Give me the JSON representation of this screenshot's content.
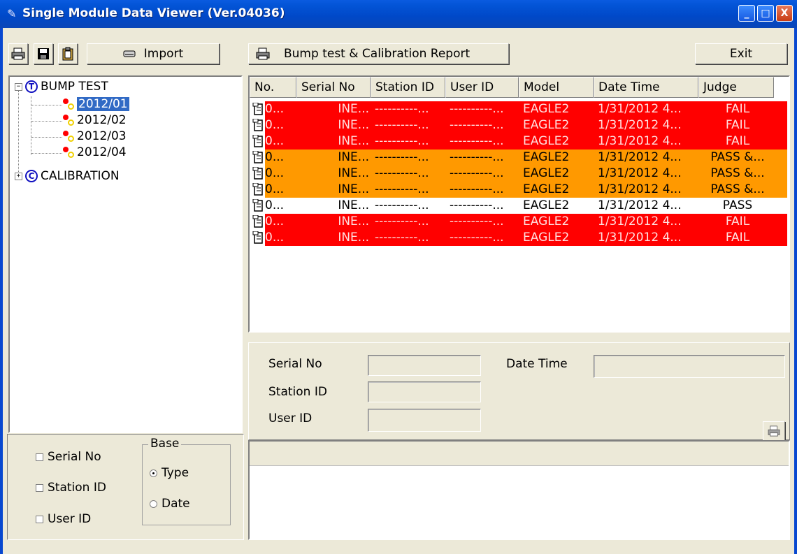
{
  "window": {
    "title": "Single Module Data Viewer (Ver.04036)",
    "minimize": "_",
    "maximize": "□",
    "close": "X"
  },
  "toolbar": {
    "import_label": "Import",
    "report_label": "Bump test & Calibration Report",
    "exit_label": "Exit"
  },
  "tree": {
    "bump_icon": "T",
    "bump_label": "BUMP TEST",
    "months": [
      "2012/01",
      "2012/02",
      "2012/03",
      "2012/04"
    ],
    "selected": "2012/01",
    "calib_icon": "C",
    "calib_label": "CALIBRATION"
  },
  "table": {
    "columns": [
      "No.",
      "Serial No",
      "Station ID",
      "User ID",
      "Model",
      "Date Time",
      "Judge"
    ],
    "rows": [
      {
        "no": "0...",
        "serial": "INE...",
        "station": "----------...",
        "user": "----------...",
        "model": "EAGLE2",
        "datetime": "1/31/2012 4...",
        "judge": "FAIL",
        "status": "fail"
      },
      {
        "no": "0...",
        "serial": "INE...",
        "station": "----------...",
        "user": "----------...",
        "model": "EAGLE2",
        "datetime": "1/31/2012 4...",
        "judge": "FAIL",
        "status": "fail"
      },
      {
        "no": "0...",
        "serial": "INE...",
        "station": "----------...",
        "user": "----------...",
        "model": "EAGLE2",
        "datetime": "1/31/2012 4...",
        "judge": "FAIL",
        "status": "fail"
      },
      {
        "no": "0...",
        "serial": "INE...",
        "station": "----------...",
        "user": "----------...",
        "model": "EAGLE2",
        "datetime": "1/31/2012 4...",
        "judge": "PASS &...",
        "status": "warn"
      },
      {
        "no": "0...",
        "serial": "INE...",
        "station": "----------...",
        "user": "----------...",
        "model": "EAGLE2",
        "datetime": "1/31/2012 4...",
        "judge": "PASS &...",
        "status": "warn"
      },
      {
        "no": "0...",
        "serial": "INE...",
        "station": "----------...",
        "user": "----------...",
        "model": "EAGLE2",
        "datetime": "1/31/2012 4...",
        "judge": "PASS &...",
        "status": "warn"
      },
      {
        "no": "0...",
        "serial": "INE...",
        "station": "----------...",
        "user": "----------...",
        "model": "EAGLE2",
        "datetime": "1/31/2012 4...",
        "judge": "PASS",
        "status": "pass"
      },
      {
        "no": "0...",
        "serial": "INE...",
        "station": "----------...",
        "user": "----------...",
        "model": "EAGLE2",
        "datetime": "1/31/2012 4...",
        "judge": "FAIL",
        "status": "fail"
      },
      {
        "no": "0...",
        "serial": "INE...",
        "station": "----------...",
        "user": "----------...",
        "model": "EAGLE2",
        "datetime": "1/31/2012 4...",
        "judge": "FAIL",
        "status": "fail"
      }
    ]
  },
  "colors": {
    "fail": "#ff0000",
    "warn": "#ff9900",
    "pass": "#ffffff",
    "selection": "#316ac5",
    "titlebar": "#0054e3"
  },
  "detail": {
    "serial_label": "Serial No",
    "station_label": "Station ID",
    "user_label": "User ID",
    "datetime_label": "Date Time",
    "serial_value": "",
    "station_value": "",
    "user_value": "",
    "datetime_value": ""
  },
  "filters": {
    "serial_label": "Serial No",
    "station_label": "Station ID",
    "user_label": "User ID",
    "base_title": "Base",
    "type_label": "Type",
    "date_label": "Date",
    "base_selected": "Type"
  },
  "icons": {
    "print": "printer-icon",
    "save": "floppy-disk-icon",
    "clipboard": "clipboard-icon",
    "import": "import-drive-icon",
    "row": "document-icon",
    "tree_leaf": "bump-record-icon"
  }
}
